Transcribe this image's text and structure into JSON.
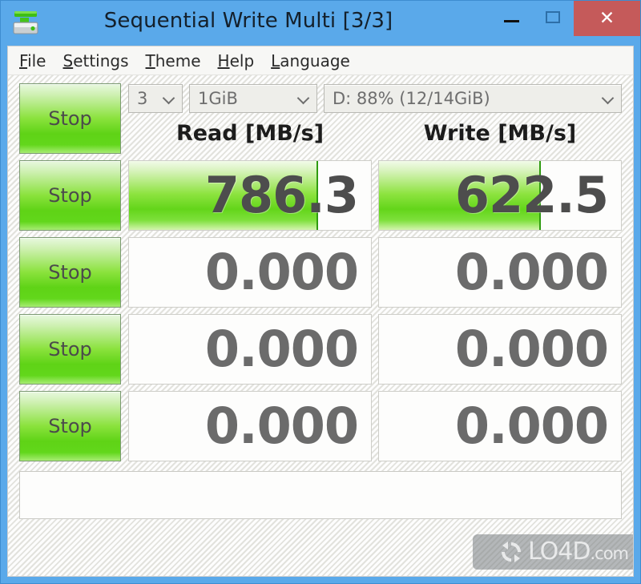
{
  "window": {
    "title": "Sequential Write Multi [3/3]",
    "icon": "disk-drive-icon",
    "accent_titlebar": "#5aa9ea",
    "close_color": "#c55a5a",
    "controls": {
      "minimize": "minimize-icon",
      "maximize": "maximize-icon",
      "close": "✕"
    }
  },
  "menubar": {
    "items": [
      {
        "mnemonic": "F",
        "rest": "ile"
      },
      {
        "mnemonic": "S",
        "rest": "ettings"
      },
      {
        "mnemonic": "T",
        "rest": "heme"
      },
      {
        "mnemonic": "H",
        "rest": "elp"
      },
      {
        "mnemonic": "L",
        "rest": "anguage"
      }
    ]
  },
  "toolbar": {
    "stop_label": "Stop",
    "test_count": "3",
    "test_size": "1GiB",
    "drive": "D: 88% (12/14GiB)"
  },
  "headers": {
    "read": "Read [MB/s]",
    "write": "Write [MB/s]"
  },
  "rows": [
    {
      "stop_label": "Stop",
      "read": {
        "value": "786.3",
        "fill_pct": 78
      },
      "write": {
        "value": "622.5",
        "fill_pct": 67
      }
    },
    {
      "stop_label": "Stop",
      "read": {
        "value": "0.000",
        "fill_pct": 0
      },
      "write": {
        "value": "0.000",
        "fill_pct": 0
      }
    },
    {
      "stop_label": "Stop",
      "read": {
        "value": "0.000",
        "fill_pct": 0
      },
      "write": {
        "value": "0.000",
        "fill_pct": 0
      }
    },
    {
      "stop_label": "Stop",
      "read": {
        "value": "0.000",
        "fill_pct": 0
      },
      "write": {
        "value": "0.000",
        "fill_pct": 0
      }
    }
  ],
  "comment": {
    "value": "",
    "placeholder": ""
  },
  "watermark": {
    "name": "LO4D",
    "domain": ".com"
  }
}
